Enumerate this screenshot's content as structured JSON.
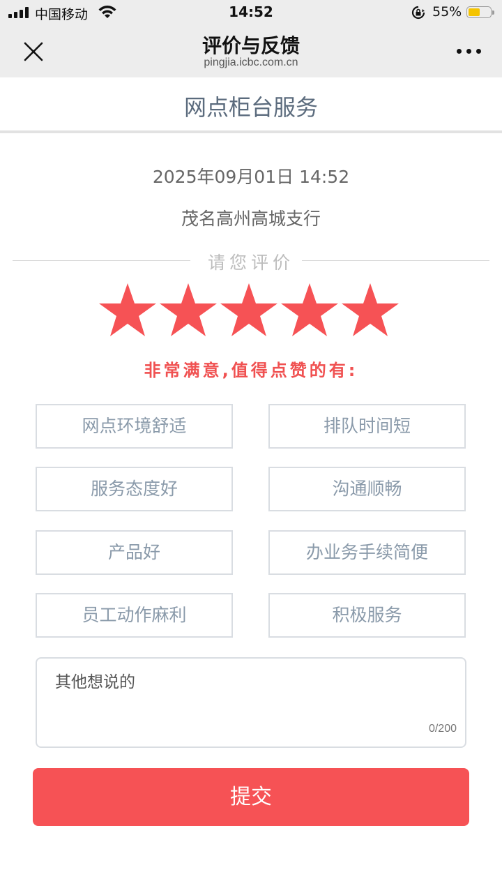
{
  "status_bar": {
    "carrier": "中国移动",
    "time": "14:52",
    "battery": "55%",
    "battery_level": 0.55,
    "battery_color": "#f5c400"
  },
  "nav": {
    "title": "评价与反馈",
    "subtitle": "pingjia.icbc.com.cn",
    "close_icon": "close-icon",
    "more_icon": "more-icon"
  },
  "page": {
    "section_title": "网点柜台服务",
    "datetime": "2025年09月01日 14:52",
    "branch": "茂名高州高城支行",
    "rate_prompt": "请您评价",
    "stars_selected": 5,
    "stars_total": 5,
    "star_color": "#f65255",
    "rating_text": "非常满意,值得点赞的有:",
    "tags": [
      "网点环境舒适",
      "排队时间短",
      "服务态度好",
      "沟通顺畅",
      "产品好",
      "办业务手续简便",
      "员工动作麻利",
      "积极服务"
    ],
    "comment_placeholder": "其他想说的",
    "comment_count": "0/200",
    "submit_label": "提交",
    "accent_color": "#f65255"
  }
}
